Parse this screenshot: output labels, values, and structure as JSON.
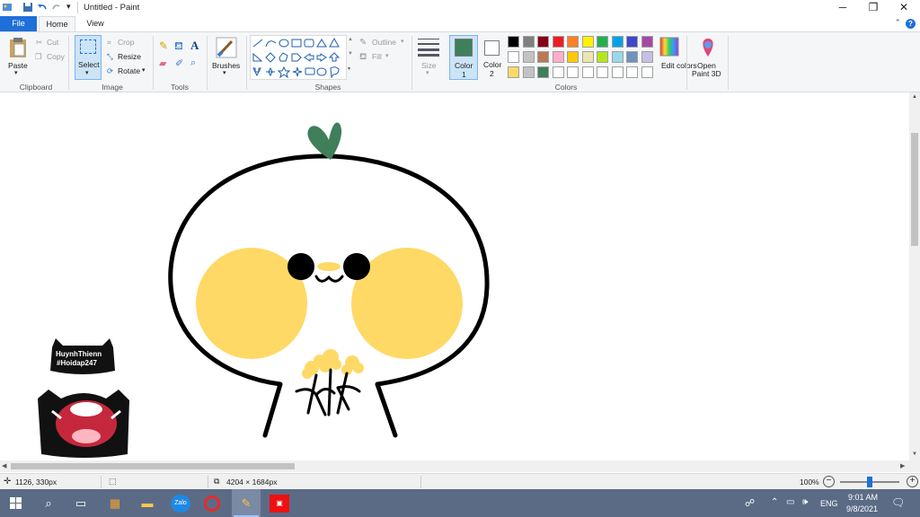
{
  "window": {
    "title": "Untitled - Paint",
    "minimize_glyph": "─",
    "maximize_glyph": "❐",
    "close_glyph": "✕",
    "help_glyph": "?"
  },
  "tabs": {
    "file": "File",
    "home": "Home",
    "view": "View"
  },
  "ribbon": {
    "clipboard": {
      "paste": "Paste",
      "cut": "Cut",
      "copy": "Copy",
      "group": "Clipboard"
    },
    "image": {
      "select": "Select",
      "crop": "Crop",
      "resize": "Resize",
      "rotate": "Rotate",
      "group": "Image"
    },
    "tools": {
      "group": "Tools"
    },
    "brushes": {
      "label": "Brushes"
    },
    "shapes": {
      "outline": "Outline",
      "fill": "Fill",
      "group": "Shapes"
    },
    "size": {
      "label": "Size"
    },
    "color1": {
      "label": "Color",
      "index": "1",
      "value": "#3f7f5a"
    },
    "color2": {
      "label": "Color",
      "index": "2",
      "value": "#ffffff"
    },
    "colors": {
      "group": "Colors",
      "edit": "Edit colors",
      "row1": [
        "#000000",
        "#7f7f7f",
        "#880015",
        "#ed1c24",
        "#ff7f27",
        "#fff200",
        "#22b14c",
        "#00a2e8",
        "#3f48cc",
        "#a349a4"
      ],
      "row2": [
        "#ffffff",
        "#c3c3c3",
        "#b97a57",
        "#ffaec9",
        "#ffc90e",
        "#efe4b0",
        "#b5e61d",
        "#99d9ea",
        "#7092be",
        "#c8bfe7"
      ],
      "row3": [
        "#ffd966",
        "#c3c3c3",
        "#3f7f5a",
        "#ffffff",
        "#ffffff",
        "#ffffff",
        "#ffffff",
        "#ffffff",
        "#ffffff",
        "#ffffff"
      ]
    },
    "paint3d": {
      "label1": "Open",
      "label2": "Paint 3D"
    }
  },
  "watermark": {
    "line1": "HuynhThienn",
    "line2": "#Hoidap247"
  },
  "status": {
    "cursor_pos": "1126, 330px",
    "image_size": "4204 × 1684px",
    "zoom": "100%",
    "zoom_level": 0.5
  },
  "taskbar": {
    "lang": "ENG",
    "time": "9:01 AM",
    "date": "9/8/2021",
    "zalo": "Zalo"
  }
}
